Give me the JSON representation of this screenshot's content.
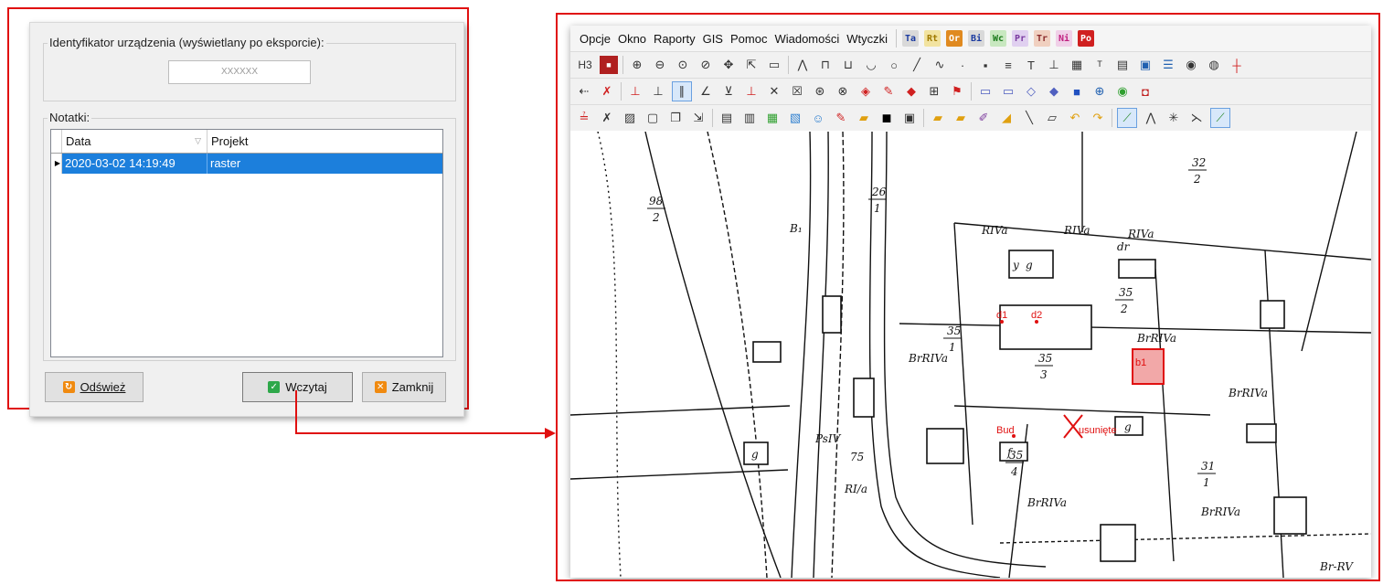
{
  "dialog": {
    "device_group_label": "Identyfikator urządzenia (wyświetlany po eksporcie):",
    "device_id_value": "XXXXXX",
    "notes_group_label": "Notatki:",
    "table": {
      "columns": [
        "Data",
        "Projekt"
      ],
      "sort_icon": "sort-triangle-icon",
      "rows": [
        {
          "data": "2020-03-02 14:19:49",
          "projekt": "raster",
          "selected": true
        }
      ]
    },
    "buttons": {
      "refresh": "Odśwież",
      "load": "Wczytaj",
      "close": "Zamknij"
    }
  },
  "app": {
    "menu": [
      "Opcje",
      "Okno",
      "Raporty",
      "GIS",
      "Pomoc",
      "Wiadomości",
      "Wtyczki"
    ],
    "plugin_chips": [
      {
        "label": "Ta",
        "color": "#1a3aa0",
        "bg": "#d9d9d9"
      },
      {
        "label": "Rt",
        "color": "#a07a00",
        "bg": "#f2e3a0"
      },
      {
        "label": "Or",
        "color": "#ffffff",
        "bg": "#e08a20"
      },
      {
        "label": "Bi",
        "color": "#1a3aa0",
        "bg": "#d9d9d9"
      },
      {
        "label": "Wc",
        "color": "#1a7a1a",
        "bg": "#c8e8c0"
      },
      {
        "label": "Pr",
        "color": "#7a3aa0",
        "bg": "#e0d0f0"
      },
      {
        "label": "Tr",
        "color": "#8a2a2a",
        "bg": "#f0d0c0"
      },
      {
        "label": "Ni",
        "color": "#c02080",
        "bg": "#f0d0e8"
      },
      {
        "label": "Po",
        "color": "#ffffff",
        "bg": "#d02020"
      }
    ],
    "toolbar1_first": "H3",
    "map_labels": {
      "parcel_98": "98",
      "parcel_98_den": "2",
      "parcel_26": "26",
      "parcel_26_den": "1",
      "parcel_32": "32",
      "parcel_32_den": "2",
      "parcel_35_1": "35",
      "parcel_35_1_den": "1",
      "parcel_35_2": "35",
      "parcel_35_2_den": "2",
      "parcel_35_3": "35",
      "parcel_35_3_den": "3",
      "parcel_35_4": "35",
      "parcel_35_4_den": "4",
      "parcel_31": "31",
      "parcel_31_den": "1",
      "parcel_75": "75",
      "rivla_1": "RIVa",
      "rivla_2": "RIVa",
      "rivla_3": "RIVa",
      "brrivla_1": "BrRIVa",
      "brrivla_2": "BrRIVa",
      "brrivla_3": "BrRIVa",
      "brrivla_4": "BrRIVa",
      "brrivla_5": "BrRIVa",
      "psiv": "PsIV",
      "ri_a": "RI/a",
      "b1": "B₁",
      "g_1": "g",
      "g_2": "g",
      "g_3": "g",
      "y_1": "y",
      "f_1": "f",
      "br_rv": "Br-RV",
      "dr": "dr",
      "red_bud": "Bud",
      "red_usun": "usunięte",
      "red_d1": "d1",
      "red_d2": "d2",
      "red_b1": "b1"
    }
  },
  "colors": {
    "highlight_frame": "#e01010",
    "selection": "#1c7fdc"
  }
}
